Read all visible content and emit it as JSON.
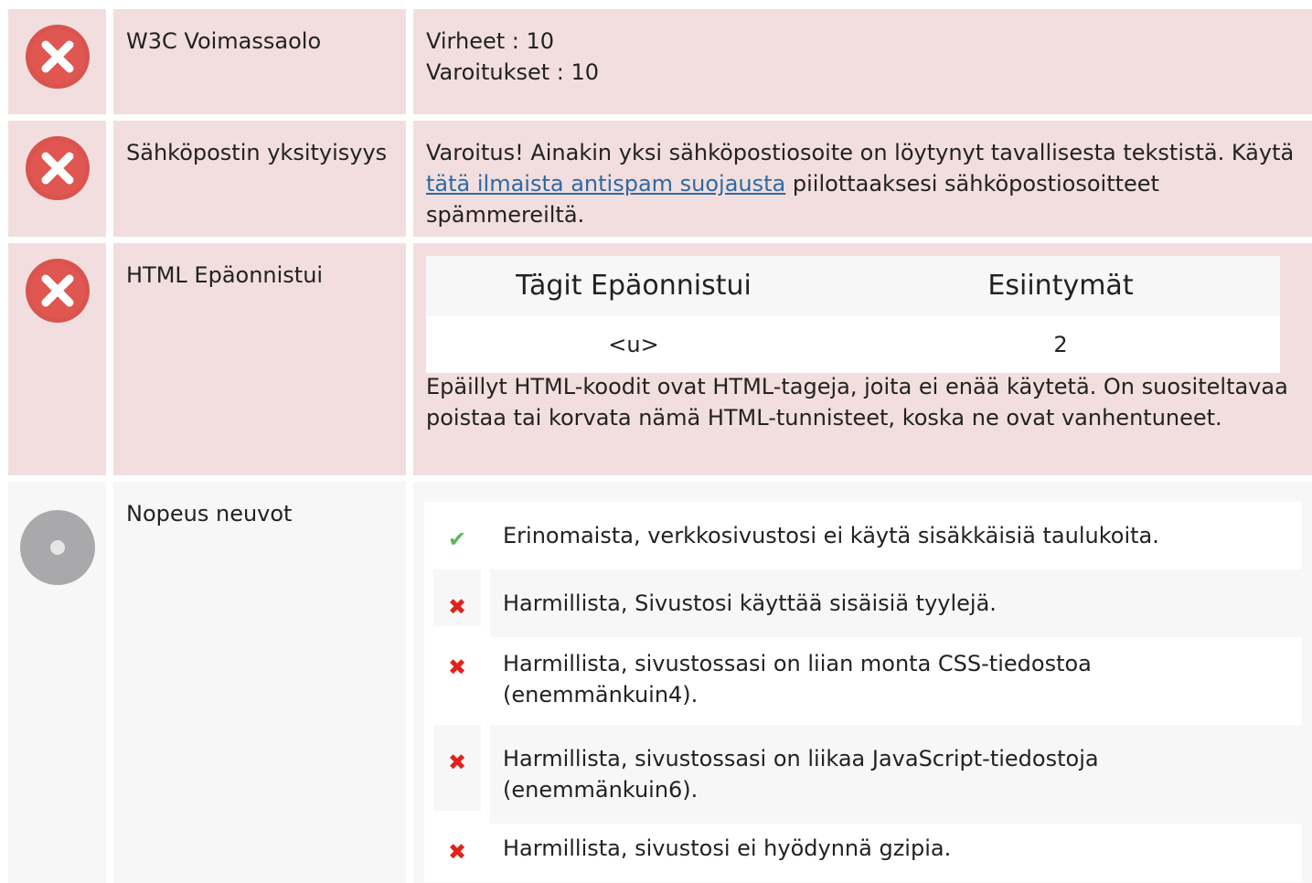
{
  "rows": {
    "w3c": {
      "status": "error",
      "label": "W3C Voimassaolo",
      "lines": [
        "Virheet : 10",
        "Varoitukset : 10"
      ]
    },
    "email": {
      "status": "error",
      "label": "Sähköpostin yksityisyys",
      "text_before": "Varoitus! Ainakin yksi sähköpostiosoite on löytynyt tavallisesta tekstistä. Käytä ",
      "link": "tätä ilmaista antispam suojausta",
      "text_after": " piilottaaksesi sähköpostiosoitteet spämmereiltä."
    },
    "html": {
      "status": "error",
      "label": "HTML Epäonnistui",
      "table": {
        "headers": [
          "Tägit Epäonnistui",
          "Esiintymät"
        ],
        "rows": [
          [
            "<u>",
            "2"
          ]
        ]
      },
      "note": "Epäillyt HTML-koodit ovat HTML-tageja, joita ei enää käytetä. On suositeltavaa poistaa tai korvata nämä HTML-tunnisteet, koska ne ovat vanhentuneet."
    },
    "speed": {
      "status": "info",
      "label": "Nopeus neuvot",
      "tips": [
        {
          "status": "ok",
          "text": "Erinomaista, verkkosivustosi ei käytä sisäkkäisiä taulukoita."
        },
        {
          "status": "fail",
          "text": "Harmillista, Sivustosi käyttää sisäisiä tyylejä."
        },
        {
          "status": "fail",
          "text": "Harmillista, sivustossasi on liian monta CSS-tiedostoa (enemmänkuin4)."
        },
        {
          "status": "fail",
          "text": "Harmillista, sivustossasi on liikaa JavaScript-tiedostoja (enemmänkuin6)."
        },
        {
          "status": "fail",
          "text": "Harmillista, sivustosi ei hyödynnä gzipia."
        }
      ]
    }
  },
  "icons": {
    "ok": "✔",
    "fail": "✖"
  },
  "colors": {
    "error_bg": "#f2dede",
    "neutral_bg": "#f7f7f7",
    "error_icon": "#d9534f",
    "ok": "#5cb85c",
    "fail": "#e0221b",
    "link": "#2d6aa3"
  }
}
